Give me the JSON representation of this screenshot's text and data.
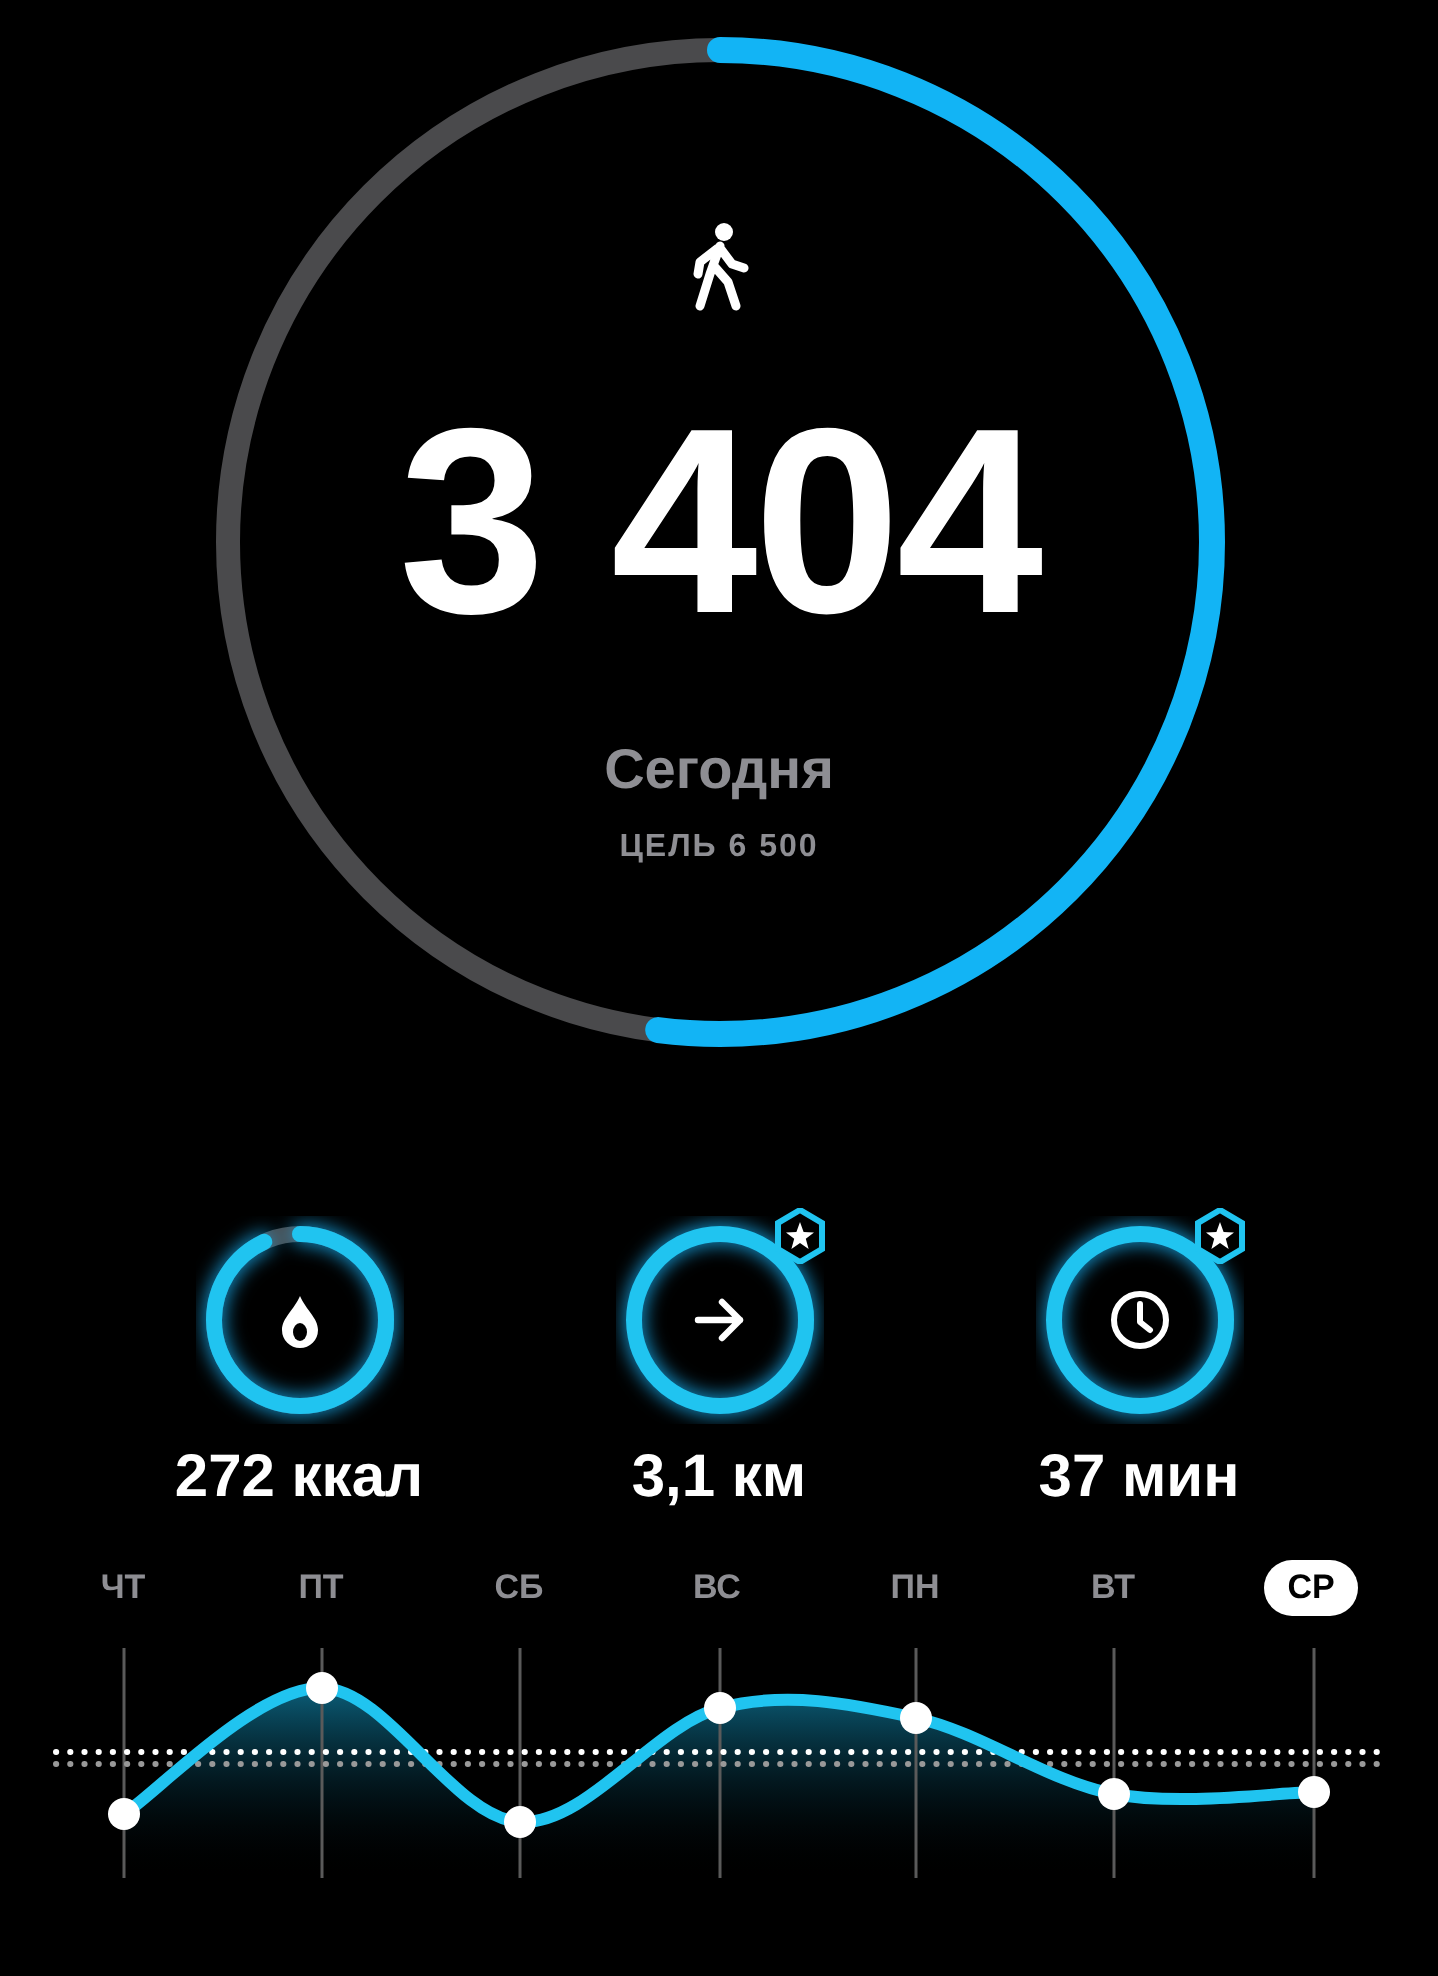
{
  "steps": {
    "count": "3 404",
    "period": "Сегодня",
    "goal": "ЦЕЛЬ 6 500"
  },
  "stats": [
    {
      "kind": "calories",
      "value": "272 ккал",
      "badge": false
    },
    {
      "kind": "distance",
      "value": "3,1 км",
      "badge": true
    },
    {
      "kind": "time",
      "value": "37 мин",
      "badge": true
    }
  ],
  "days": [
    {
      "label": "ЧТ",
      "selected": false
    },
    {
      "label": "ПТ",
      "selected": false
    },
    {
      "label": "СБ",
      "selected": false
    },
    {
      "label": "ВС",
      "selected": false
    },
    {
      "label": "ПН",
      "selected": false
    },
    {
      "label": "ВТ",
      "selected": false
    },
    {
      "label": "СР",
      "selected": true
    }
  ]
}
